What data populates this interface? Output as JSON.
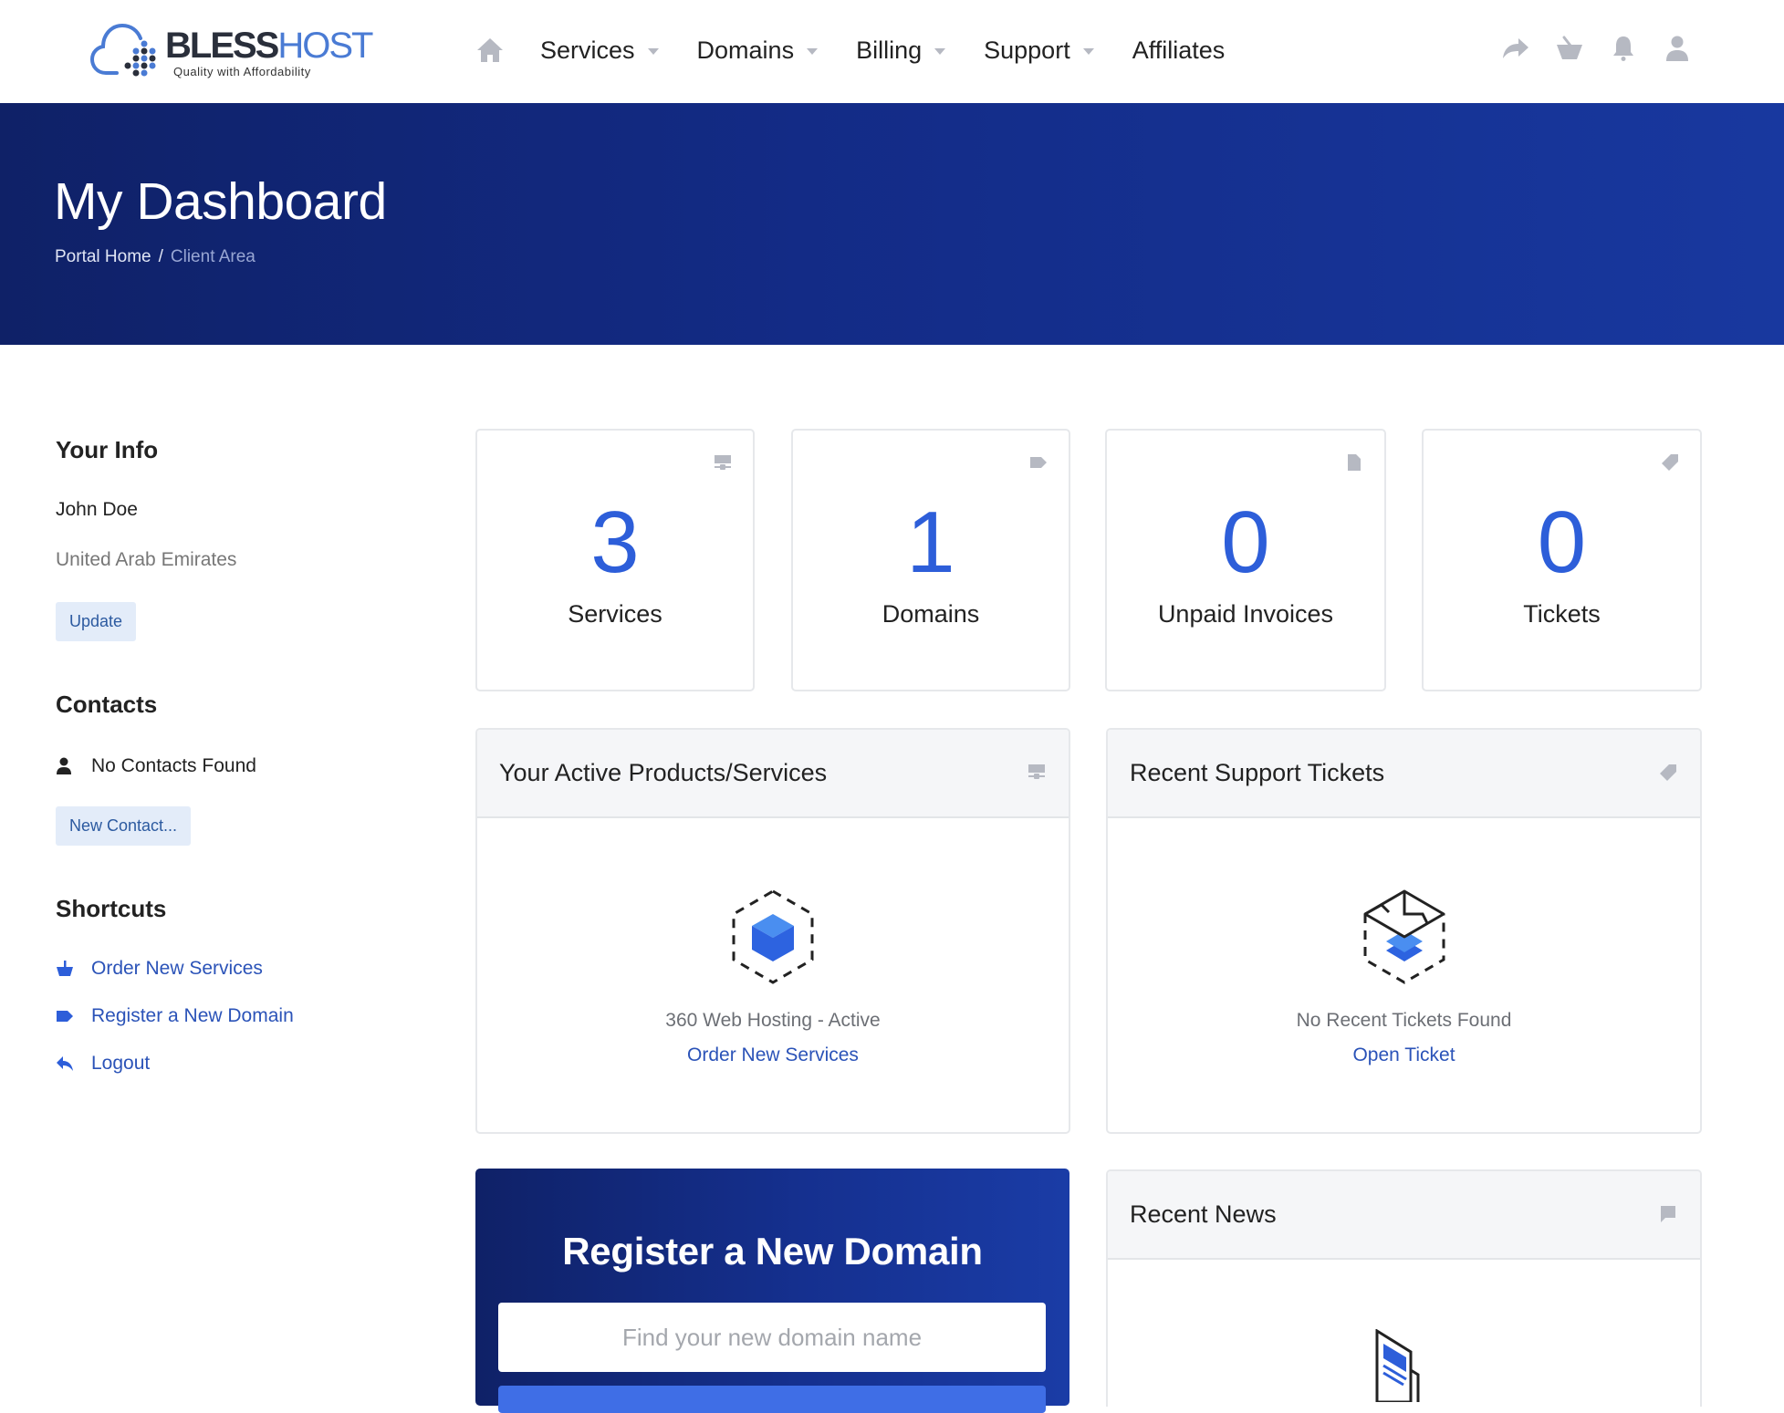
{
  "brand": {
    "name_part1": "BLESS",
    "name_part2": "HOST",
    "tagline": "Quality with Affordability"
  },
  "nav": {
    "home_icon": "home-icon",
    "items": [
      {
        "label": "Services",
        "dropdown": true
      },
      {
        "label": "Domains",
        "dropdown": true
      },
      {
        "label": "Billing",
        "dropdown": true
      },
      {
        "label": "Support",
        "dropdown": true
      },
      {
        "label": "Affiliates",
        "dropdown": false
      }
    ],
    "right_icons": [
      "share-icon",
      "cart-basket-icon",
      "bell-icon",
      "user-icon"
    ]
  },
  "banner": {
    "title": "My Dashboard",
    "breadcrumb": [
      {
        "label": "Portal Home",
        "link": true
      },
      {
        "label": "Client Area",
        "link": false
      }
    ],
    "separator": "/"
  },
  "sidebar": {
    "your_info": {
      "heading": "Your Info",
      "name": "John Doe",
      "country": "United Arab Emirates",
      "update_label": "Update"
    },
    "contacts": {
      "heading": "Contacts",
      "empty_text": "No Contacts Found",
      "new_contact_label": "New Contact..."
    },
    "shortcuts": {
      "heading": "Shortcuts",
      "items": [
        {
          "label": "Order New Services",
          "icon": "basket-icon"
        },
        {
          "label": "Register a New Domain",
          "icon": "tag-icon"
        },
        {
          "label": "Logout",
          "icon": "reply-arrow-icon"
        }
      ]
    }
  },
  "stats": [
    {
      "value": "3",
      "label": "Services",
      "icon": "server-icon"
    },
    {
      "value": "1",
      "label": "Domains",
      "icon": "tag-icon"
    },
    {
      "value": "0",
      "label": "Unpaid Invoices",
      "icon": "file-icon"
    },
    {
      "value": "0",
      "label": "Tickets",
      "icon": "ticket-tag-icon"
    }
  ],
  "panels": {
    "products": {
      "title": "Your Active Products/Services",
      "icon": "server-icon",
      "empty_text": "360 Web Hosting - Active",
      "link_label": "Order New Services"
    },
    "tickets": {
      "title": "Recent Support Tickets",
      "icon": "ticket-tag-icon",
      "empty_text": "No Recent Tickets Found",
      "link_label": "Open Ticket"
    },
    "news": {
      "title": "Recent News",
      "icon": "comment-flag-icon"
    }
  },
  "domain_search": {
    "title": "Register a New Domain",
    "placeholder": "Find your new domain name",
    "value": ""
  },
  "colors": {
    "accent": "#2d5ed9",
    "link": "#2b53b8",
    "banner_start": "#0f2167",
    "banner_end": "#18389f",
    "icon_gray": "#b6b9c2"
  }
}
